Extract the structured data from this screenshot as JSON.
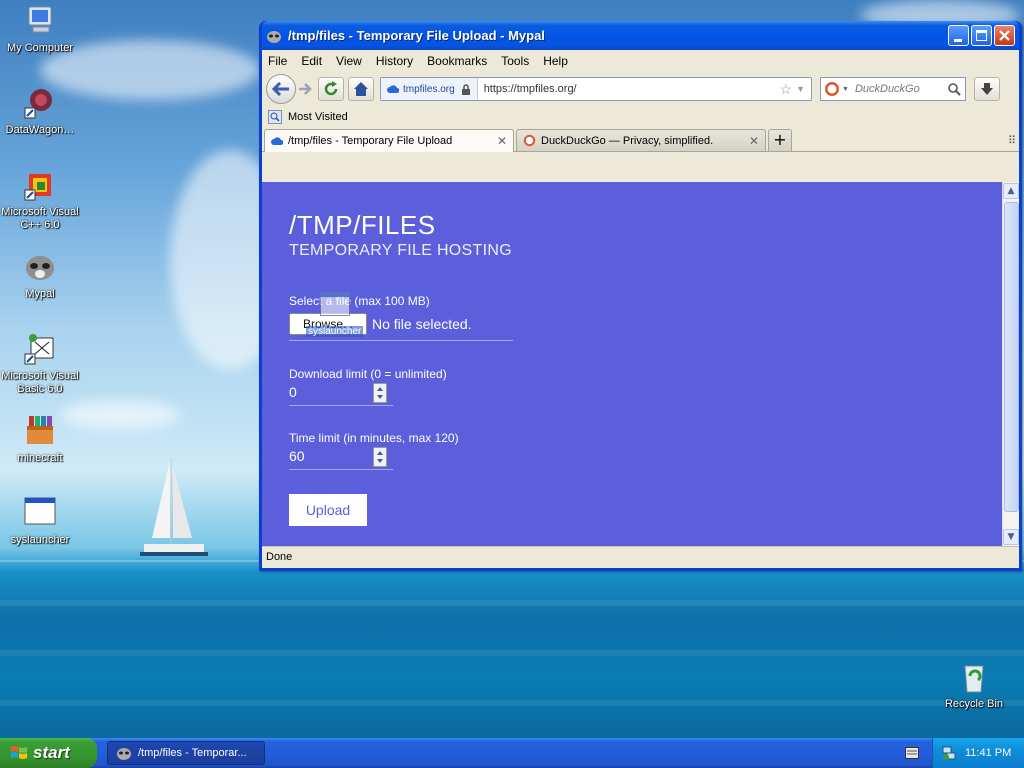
{
  "desktop": {
    "icons": [
      {
        "label": "My Computer",
        "icon": "computer-icon"
      },
      {
        "label": "DataWagon…",
        "icon": "datawagon-icon"
      },
      {
        "label": "Microsoft Visual C++ 6.0",
        "icon": "visual-cpp-icon"
      },
      {
        "label": "Mypal",
        "icon": "mypal-icon"
      },
      {
        "label": "Microsoft Visual Basic 6.0",
        "icon": "visual-basic-icon"
      },
      {
        "label": "minecraft",
        "icon": "minecraft-icon"
      },
      {
        "label": "syslauncher",
        "icon": "window-app-icon"
      },
      {
        "label": "Recycle Bin",
        "icon": "recycle-bin-icon"
      }
    ]
  },
  "window": {
    "title": "/tmp/files - Temporary File Upload - Mypal"
  },
  "menu": [
    "File",
    "Edit",
    "View",
    "History",
    "Bookmarks",
    "Tools",
    "Help"
  ],
  "navbar": {
    "identity": "tmpfiles.org",
    "url": "https://tmpfiles.org/",
    "search_placeholder": "DuckDuckGo"
  },
  "bookmarks": {
    "most_visited": "Most Visited"
  },
  "tabs": [
    {
      "label": "/tmp/files - Temporary File Upload",
      "active": true
    },
    {
      "label": "DuckDuckGo — Privacy, simplified.",
      "active": false
    }
  ],
  "page": {
    "title": "/TMP/FILES",
    "subtitle": "TEMPORARY FILE HOSTING",
    "file_label": "Select a file (max 100 MB)",
    "browse_label": "Browse...",
    "no_file_text": "No file selected.",
    "download_label": "Download limit (0 = unlimited)",
    "download_value": "0",
    "time_label": "Time limit (in minutes, max 120)",
    "time_value": "60",
    "upload_label": "Upload",
    "drag_ghost_label": "syslauncher",
    "background_color": "#5b5fdc"
  },
  "status": {
    "text": "Done"
  },
  "taskbar": {
    "start_label": "start",
    "task_label": "/tmp/files - Temporar...",
    "clock": "11:41 PM"
  }
}
